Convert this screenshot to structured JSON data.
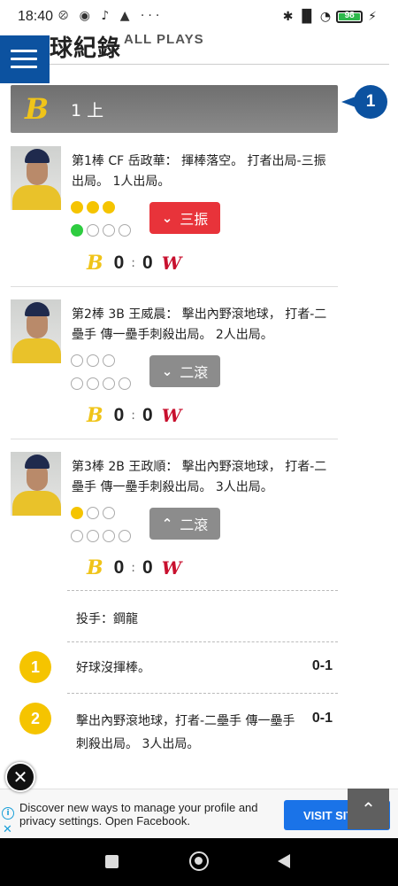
{
  "status_bar": {
    "time": "18:40",
    "left_icons": "⦼ ◉ ♪ ▲ ···",
    "right_icons": "✱ ▐▌ ◔",
    "battery": "98",
    "battery_color": "#2db84b"
  },
  "header": {
    "menu_icon": "hamburger-menu-icon",
    "title": "逐球紀錄",
    "title_visible": "球紀錄",
    "subtitle": "ALL PLAYS"
  },
  "inning": {
    "team_logo": "B",
    "label": "1 上",
    "badge": "1",
    "bar_color": "#7a7a7a",
    "badge_color": "#0c52a0"
  },
  "plays": [
    {
      "description": "第1棒 CF 岳政華： 揮棒落空。 打者出局-三振出局。 1人出局。",
      "balls_filled": 3,
      "strikes_filled": 1,
      "result_label": "三振",
      "result_icon": "chevron-down-icon",
      "result_color": "#e8333a",
      "away_logo": "B",
      "away_score": "0",
      "home_score": "0",
      "home_logo": "W"
    },
    {
      "description": "第2棒 3B 王威晨： 擊出內野滾地球， 打者-二壘手 傳一壘手刺殺出局。 2人出局。",
      "balls_filled": 0,
      "strikes_filled": 0,
      "result_label": "二滾",
      "result_icon": "chevron-down-icon",
      "result_color": "#8c8c8c",
      "away_logo": "B",
      "away_score": "0",
      "home_score": "0",
      "home_logo": "W"
    },
    {
      "description": "第3棒 2B 王政順： 擊出內野滾地球， 打者-二壘手 傳一壘手刺殺出局。 3人出局。",
      "balls_filled": 1,
      "strikes_filled": 0,
      "result_label": "二滾",
      "result_icon": "chevron-up-icon",
      "result_color": "#8c8c8c",
      "away_logo": "B",
      "away_score": "0",
      "home_score": "0",
      "home_logo": "W"
    }
  ],
  "detail": {
    "pitcher": "投手：鋼龍",
    "pitches": [
      {
        "number": "1",
        "text": "好球沒揮棒。",
        "count": "0-1"
      },
      {
        "number": "2",
        "text": "擊出內野滾地球，打者-二壘手 傳一壘手刺殺出局。 3人出局。",
        "count": "0-1"
      }
    ]
  },
  "ad": {
    "text": "Discover new ways to manage your profile and privacy settings. Open Facebook.",
    "button": "VISIT SITE",
    "info_icon": "info-icon",
    "close_icon": "close-icon"
  },
  "floating": {
    "close_icon": "close-circle-icon",
    "scroll_top_icon": "chevron-up-icon"
  },
  "nav_bar": {
    "recents_icon": "recents-square-icon",
    "home_icon": "home-circle-icon",
    "back_icon": "back-triangle-icon"
  }
}
